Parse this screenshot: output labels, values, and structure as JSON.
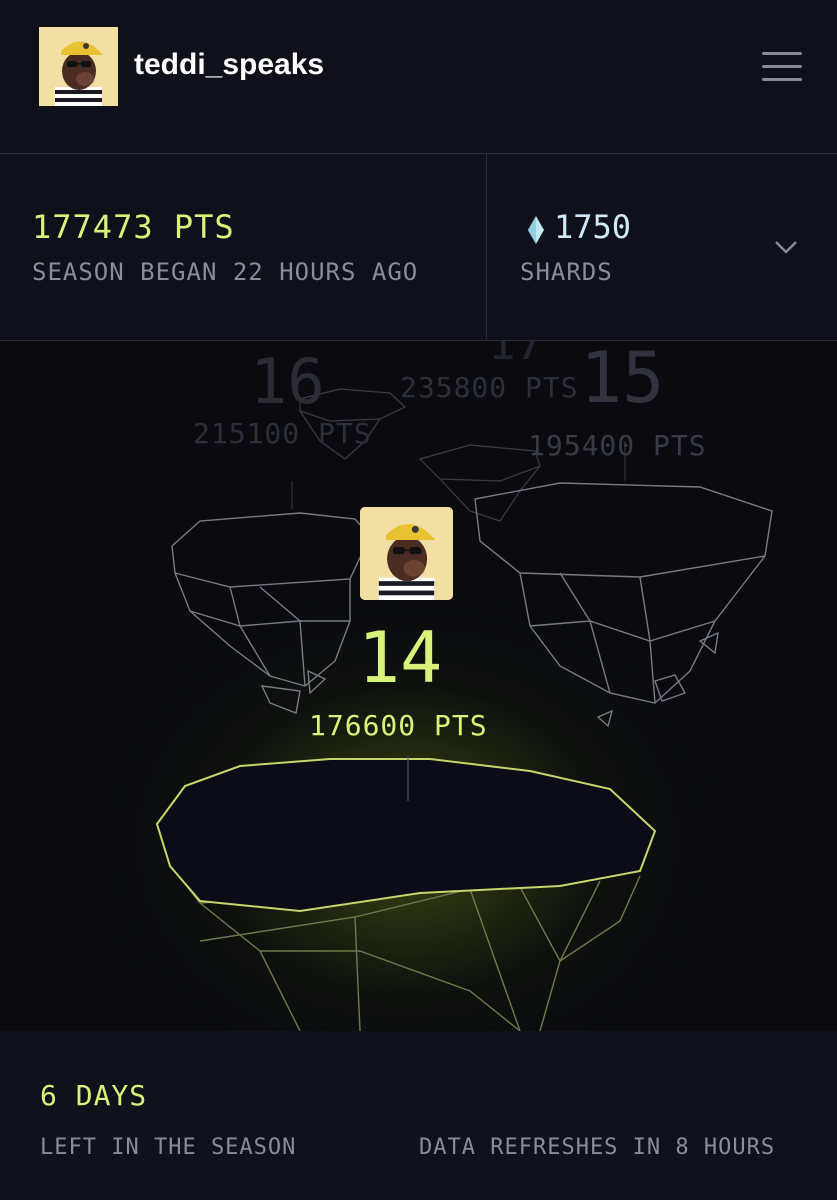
{
  "header": {
    "username": "teddi_speaks",
    "avatar_icon": "bear-avatar",
    "menu_icon": "hamburger-menu-icon"
  },
  "stats": {
    "points": "177473 PTS",
    "season_began": "SEASON BEGAN 22 HOURS AGO",
    "shards_value": "1750",
    "shards_label": "SHARDS",
    "shard_icon": "diamond-shard-icon",
    "expand_icon": "chevron-down-icon"
  },
  "leaderboard": {
    "others": [
      {
        "rank": "17",
        "points": "235800 PTS"
      },
      {
        "rank": "16",
        "points": "215100 PTS"
      },
      {
        "rank": "15",
        "points": "195400 PTS"
      }
    ],
    "current": {
      "rank": "14",
      "points": "176600 PTS"
    }
  },
  "footer": {
    "days_left": "6 DAYS",
    "left_label": "LEFT IN THE SEASON",
    "refresh_label": "DATA REFRESHES IN 8 HOURS"
  },
  "colors": {
    "accent": "#d8f37a",
    "background": "#0f0f19",
    "muted_text": "#8c8c99"
  }
}
